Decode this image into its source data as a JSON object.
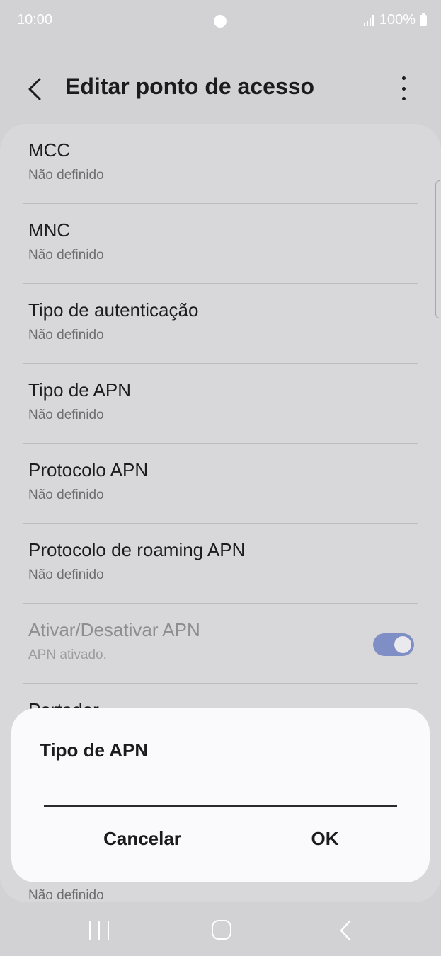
{
  "status_bar": {
    "time": "10:00",
    "battery": "100%"
  },
  "header": {
    "title": "Editar ponto de acesso",
    "back_icon": "chevron-left-icon",
    "more_icon": "more-vertical-icon"
  },
  "settings": {
    "items": [
      {
        "title": "MCC",
        "value": "Não definido"
      },
      {
        "title": "MNC",
        "value": "Não definido"
      },
      {
        "title": "Tipo de autenticação",
        "value": "Não definido"
      },
      {
        "title": "Tipo de APN",
        "value": "Não definido"
      },
      {
        "title": "Protocolo APN",
        "value": "Não definido"
      },
      {
        "title": "Protocolo de roaming APN",
        "value": "Não definido"
      },
      {
        "title": "Ativar/Desativar APN",
        "value": "APN ativado.",
        "toggle": true,
        "enabled": false
      },
      {
        "title": "Portador",
        "value": "Não definido"
      }
    ]
  },
  "dialog": {
    "title": "Tipo de APN",
    "input_value": "",
    "cancel_label": "Cancelar",
    "ok_label": "OK"
  },
  "nav_bar": {
    "recent_icon": "recent-apps-icon",
    "home_icon": "home-icon",
    "back_icon": "back-icon"
  },
  "colors": {
    "background": "#d2d2d4",
    "card": "#d8d8da",
    "toggle_on": "#7f8fc6",
    "dialog": "#fafafc"
  }
}
